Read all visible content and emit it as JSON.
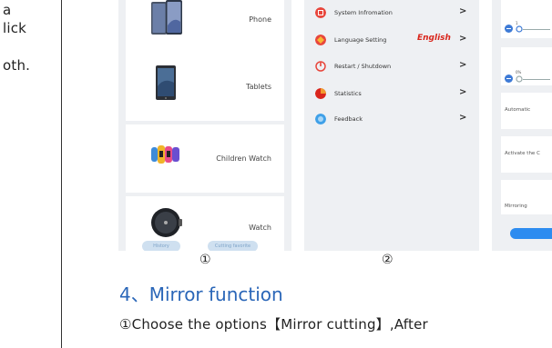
{
  "left_fragments": [
    "a",
    "lick",
    "oth."
  ],
  "devices": [
    {
      "label": "Phone"
    },
    {
      "label": "Tablets"
    },
    {
      "label": "Children Watch"
    },
    {
      "label": "Watch"
    }
  ],
  "history_buttons": [
    "History",
    "Cutting favorite"
  ],
  "menu": [
    {
      "label": "System Infromation",
      "icon": "system-info-icon",
      "color": "#e8463c"
    },
    {
      "label": "Language Setting",
      "icon": "language-icon",
      "color": "#e8463c",
      "value": "English"
    },
    {
      "label": "Restart / Shutdown",
      "icon": "power-icon",
      "color": "#e8463c"
    },
    {
      "label": "Statistics",
      "icon": "statistics-icon",
      "color": "#d9261c"
    },
    {
      "label": "Feedback",
      "icon": "feedback-icon",
      "color": "#3fa0e8"
    }
  ],
  "menu_arrow": ">",
  "settings_panel": {
    "slider1_value": "1",
    "slider2_value": "0%",
    "rows": [
      "Automatic",
      "Activate the C",
      "Mirroring"
    ]
  },
  "captions": [
    "①",
    "②"
  ],
  "section_heading": "4、Mirror function",
  "body_text_1": "①Choose the options【Mirror cutting】,After",
  "colors": {
    "heading": "#2a66b8",
    "accent_blue": "#3d7ad6",
    "english_red": "#d9261c"
  }
}
